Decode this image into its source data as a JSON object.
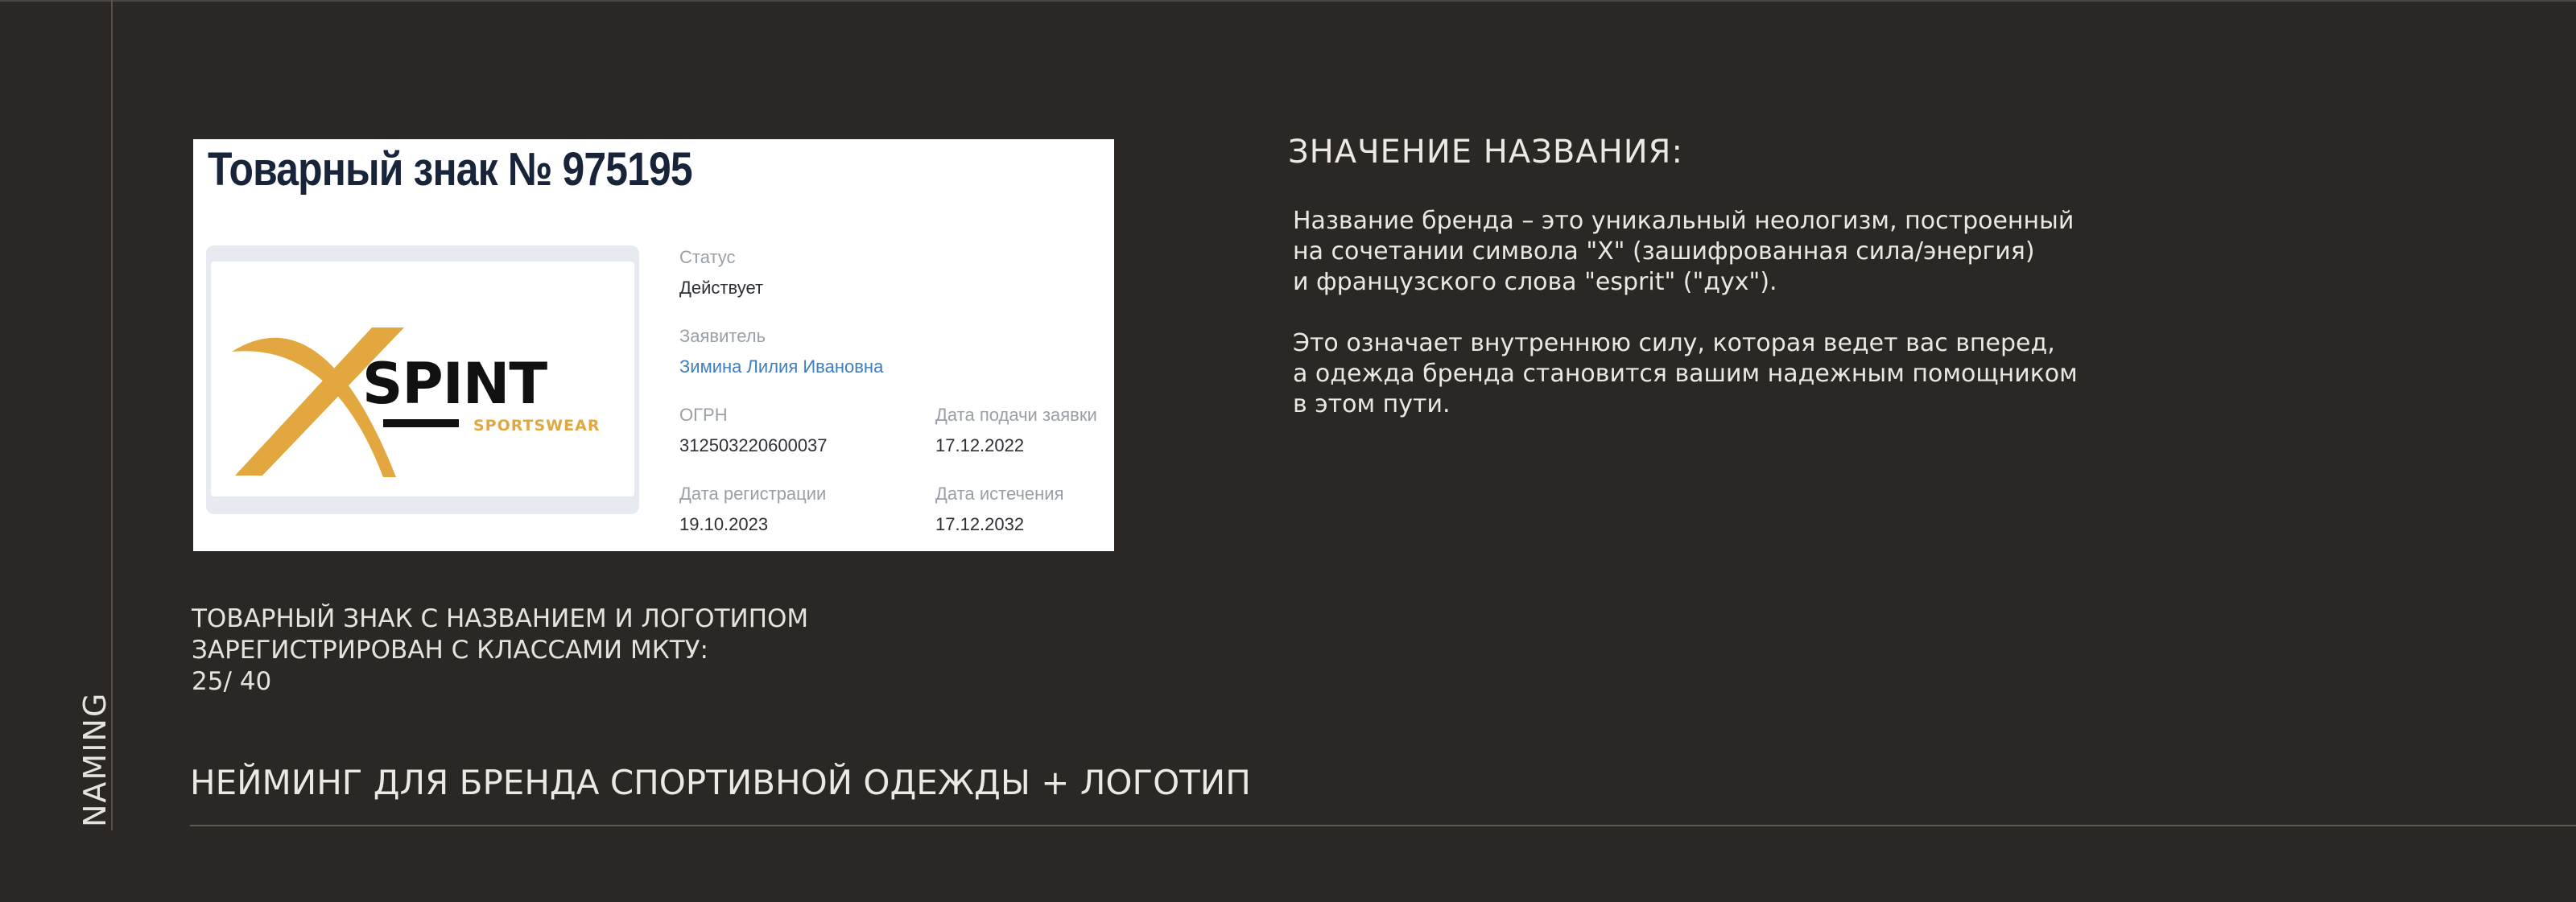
{
  "side_label": "NAMING",
  "footer_title": "НЕЙМИНГ ДЛЯ БРЕНДА СПОРТИВНОЙ ОДЕЖДЫ + ЛОГОТИП",
  "trademark": {
    "title": "Товарный знак № 975195",
    "logo": {
      "main": "SPINT",
      "sub": "SPORTSWEAR",
      "accent_color": "#e3a73f",
      "text_color": "#111111"
    },
    "status_label": "Статус",
    "status_value": "Действует",
    "applicant_label": "Заявитель",
    "applicant_value": "Зимина Лилия Ивановна",
    "ogrn_label": "ОГРН",
    "ogrn_value": "312503220600037",
    "filing_date_label": "Дата подачи заявки",
    "filing_date_value": "17.12.2022",
    "registration_date_label": "Дата регистрации",
    "registration_date_value": "19.10.2023",
    "expiry_date_label": "Дата истечения",
    "expiry_date_value": "17.12.2032"
  },
  "caption": {
    "line1": "ТОВАРНЫЙ ЗНАК С НАЗВАНИЕМ И ЛОГОТИПОМ",
    "line2": "ЗАРЕГИСТРИРОВАН С КЛАССАМИ МКТУ:",
    "line3": "25/ 40"
  },
  "meaning": {
    "title": "ЗНАЧЕНИЕ НАЗВАНИЯ:",
    "p1_line1": "Название бренда – это уникальный неологизм, построенный",
    "p1_line2": "на сочетании символа \"X\" (зашифрованная сила/энергия)",
    "p1_line3": "и французского слова \"esprit\" (\"дух\").",
    "p2_line1": "Это означает внутреннюю силу, которая ведет вас вперед,",
    "p2_line2": "а одежда бренда становится вашим надежным помощником",
    "p2_line3": "в этом пути."
  }
}
